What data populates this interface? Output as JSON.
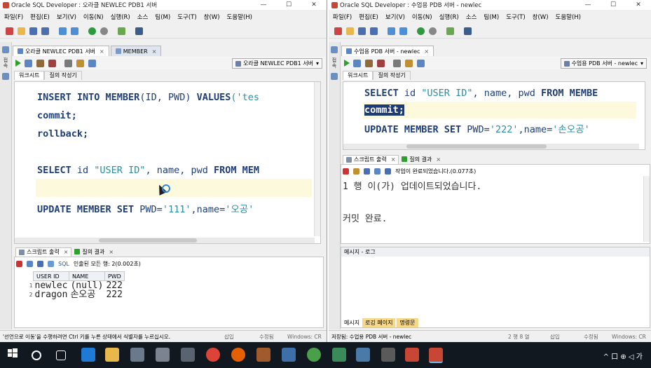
{
  "left": {
    "title": "Oracle SQL Developer : 오라클 NEWLEC PDB1 서버",
    "menu": [
      "파일(F)",
      "편집(E)",
      "보기(V)",
      "이동(N)",
      "실행(R)",
      "소스",
      "팀(M)",
      "도구(T)",
      "창(W)",
      "도움말(H)"
    ],
    "tabs": [
      "오라클 NEWLEC PDB1 서버",
      "MEMBER"
    ],
    "connection": "오라클 NEWLEC PDB1 서버",
    "subtabs": [
      "워크시트",
      "질의 작성기"
    ],
    "code": {
      "l1_kw1": "INSERT INTO MEMBER",
      "l1_rest": "(ID, PWD) ",
      "l1_kw2": "VALUES",
      "l1_str": "('tes",
      "l2": "commit;",
      "l3": "rollback;",
      "l4_kw1": "SELECT",
      "l4_a": " id ",
      "l4_str": "\"USER ID\"",
      "l4_b": ", name, pwd ",
      "l4_kw2": "FROM MEM",
      "l6_kw": "UPDATE MEMBER SET",
      "l6_a": " PWD=",
      "l6_str": "'111'",
      "l6_b": ",name=",
      "l6_str2": "'오공'"
    },
    "panel_tabs": [
      "스크립트 출력",
      "질의 결과"
    ],
    "result_status": "인출된 모든 행: 2(0.002초)",
    "sql_label": "SQL",
    "columns": [
      "USER ID",
      "NAME",
      "PWD"
    ],
    "rows": [
      {
        "n": "1",
        "id": "newlec",
        "name": "(null)",
        "pwd": "222"
      },
      {
        "n": "2",
        "id": "dragon",
        "name": "손오공",
        "pwd": "222"
      }
    ],
    "status": "'선언으로 이동'을 수행하려면 Ctrl 키를 누른 상태에서 식별자를 누르십시오.",
    "status_r1": "삽입",
    "status_r2": "수정됨",
    "status_r3": "Windows: CR"
  },
  "right": {
    "title": "Oracle SQL Developer : 수업용 PDB 서버 - newlec",
    "menu": [
      "파일(F)",
      "편집(E)",
      "보기(V)",
      "이동(N)",
      "실행(R)",
      "소스",
      "팀(M)",
      "도구(T)",
      "창(W)",
      "도움말(H)"
    ],
    "tabs": [
      "수업용 PDB 서버 - newlec"
    ],
    "connection": "수업용 PDB 서버 - newlec",
    "subtabs": [
      "워크시트",
      "질의 작성기"
    ],
    "code": {
      "l1_kw1": "SELECT",
      "l1_a": " id ",
      "l1_str": "\"USER ID\"",
      "l1_b": ", name, pwd ",
      "l1_kw2": "FROM MEMBE",
      "l2": "commit;",
      "l3_kw": "UPDATE MEMBER SET",
      "l3_a": " PWD=",
      "l3_str": "'222'",
      "l3_b": ",name=",
      "l3_str2": "'손오공'"
    },
    "panel_tabs": [
      "스크립트 출력",
      "질의 결과"
    ],
    "task_status": "작업이 완료되었습니다.(0.077초)",
    "output_lines": [
      "1 행 이(가) 업데이트되었습니다.",
      "커밋 완료."
    ],
    "msg_title": "메시지 - 로그",
    "bottom_tabs": [
      "메시지",
      "로깅 페이지",
      "명령문"
    ],
    "status": "저장됨: 수업용 PDB 서버 - newlec",
    "status_pos": "2 행 8 열",
    "status_r1": "삽입",
    "status_r2": "수정됨",
    "status_r3": "Windows: CR"
  },
  "taskbar": {
    "tray_text": "^ 口 ⊕ ◁ 가"
  }
}
